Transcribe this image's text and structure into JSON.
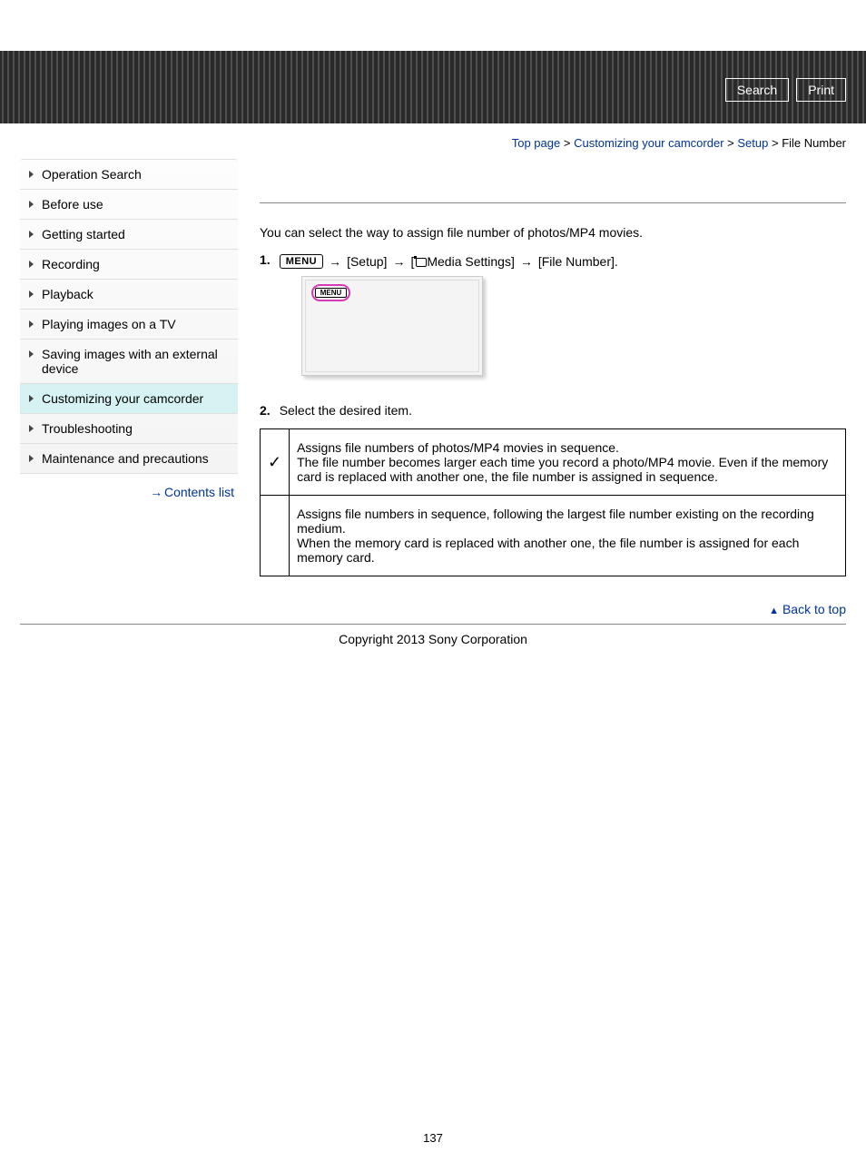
{
  "header": {
    "search_label": "Search",
    "print_label": "Print"
  },
  "breadcrumb": {
    "items": [
      "Top page",
      "Customizing your camcorder",
      "Setup"
    ],
    "current": "File Number"
  },
  "sidebar": {
    "items": [
      "Operation Search",
      "Before use",
      "Getting started",
      "Recording",
      "Playback",
      "Playing images on a TV",
      "Saving images with an external device",
      "Customizing your camcorder",
      "Troubleshooting",
      "Maintenance and precautions"
    ],
    "active_index": 7,
    "contents_list": "Contents list"
  },
  "main": {
    "intro": "You can select the way to assign file number of photos/MP4 movies.",
    "step1_num": "1.",
    "menu_box": "MENU",
    "path_parts": {
      "setup": "[Setup]",
      "media_prefix": "[",
      "media": "Media Settings]",
      "file_number": "[File Number]."
    },
    "menu_tag": "MENU",
    "step2_num": "2.",
    "select_text": "Select the desired item.",
    "options": [
      {
        "checked": true,
        "line1": "Assigns file numbers of photos/MP4 movies in sequence.",
        "line2": "The file number becomes larger each time you record a photo/MP4 movie. Even if the memory card is replaced with another one, the file number is assigned in sequence."
      },
      {
        "checked": false,
        "line1": "Assigns file numbers in sequence, following the largest file number existing on the recording medium.",
        "line2": "When the memory card is replaced with another one, the file number is assigned for each memory card."
      }
    ]
  },
  "footer": {
    "back_to_top": "Back to top",
    "copyright": "Copyright 2013 Sony Corporation",
    "page_num": "137"
  }
}
